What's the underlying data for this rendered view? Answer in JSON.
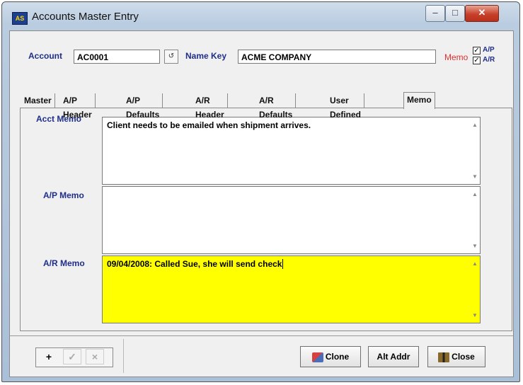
{
  "window": {
    "title": "Accounts Master Entry",
    "app_icon_text": "AS"
  },
  "header": {
    "account_label": "Account",
    "account_value": "AC0001",
    "name_key_label": "Name Key",
    "name_key_value": "ACME COMPANY",
    "memo_flag": "Memo",
    "ap_label": "A/P",
    "ar_label": "A/R",
    "ap_checked": true,
    "ar_checked": true
  },
  "tabs": [
    {
      "label": "Master"
    },
    {
      "label": "A/P Header"
    },
    {
      "label": "A/P Defaults"
    },
    {
      "label": "A/R Header"
    },
    {
      "label": "A/R Defaults"
    },
    {
      "label": "User Defined"
    },
    {
      "label": "Memo",
      "active": true
    }
  ],
  "memos": {
    "acct_label": "Acct Memo",
    "acct_value": "Client needs to be emailed when shipment arrives.",
    "ap_label": "A/P Memo",
    "ap_value": "",
    "ar_label": "A/R Memo",
    "ar_value": "09/04/2008: Called Sue, she will send check",
    "ar_highlight_color": "#ffff00"
  },
  "footer": {
    "add_symbol": "+",
    "confirm_symbol": "✓",
    "cancel_symbol": "×",
    "clone_label": "Clone",
    "alt_addr_label": "Alt Addr",
    "close_label": "Close"
  }
}
